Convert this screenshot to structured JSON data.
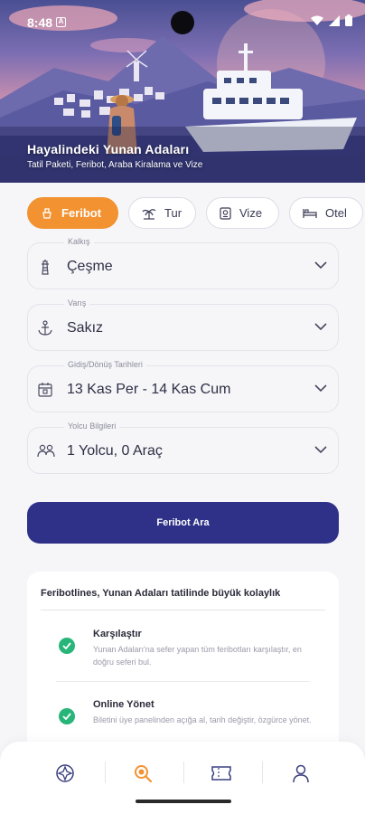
{
  "status_bar": {
    "time": "8:48",
    "a_badge": "A"
  },
  "hero": {
    "title": "Hayalindeki Yunan Adaları",
    "subtitle": "Tatil Paketi, Feribot, Araba Kiralama ve Vize"
  },
  "tabs": [
    {
      "label": "Feribot",
      "icon": "ferry-icon",
      "active": true
    },
    {
      "label": "Tur",
      "icon": "palm-tree-icon",
      "active": false
    },
    {
      "label": "Vize",
      "icon": "passport-icon",
      "active": false
    },
    {
      "label": "Otel",
      "icon": "bed-icon",
      "active": false
    }
  ],
  "fields": {
    "departure": {
      "label": "Kalkış",
      "value": "Çeşme",
      "icon": "lighthouse-icon"
    },
    "arrival": {
      "label": "Varış",
      "value": "Sakız",
      "icon": "anchor-icon"
    },
    "dates": {
      "label": "Gidiş/Dönüş Tarihleri",
      "value": "13 Kas Per - 14 Kas Cum",
      "icon": "calendar-icon"
    },
    "passengers": {
      "label": "Yolcu Bilgileri",
      "value": "1 Yolcu, 0 Araç",
      "icon": "passengers-icon"
    }
  },
  "search_button": "Feribot Ara",
  "info_card": {
    "title": "Feribotlines, Yunan Adaları tatilinde büyük kolaylık",
    "features": [
      {
        "title": "Karşılaştır",
        "description": "Yunan Adaları'na sefer yapan tüm feribotları karşılaştır, en doğru seferi bul."
      },
      {
        "title": "Online Yönet",
        "description": "Biletini üye panelinden açığa al, tarih değiştir, özgürce yönet."
      }
    ]
  },
  "bottom_nav": [
    "explore-icon",
    "search-icon",
    "ticket-icon",
    "profile-icon"
  ],
  "colors": {
    "accent": "#f39231",
    "primary": "#2e3187",
    "success": "#27b579"
  }
}
